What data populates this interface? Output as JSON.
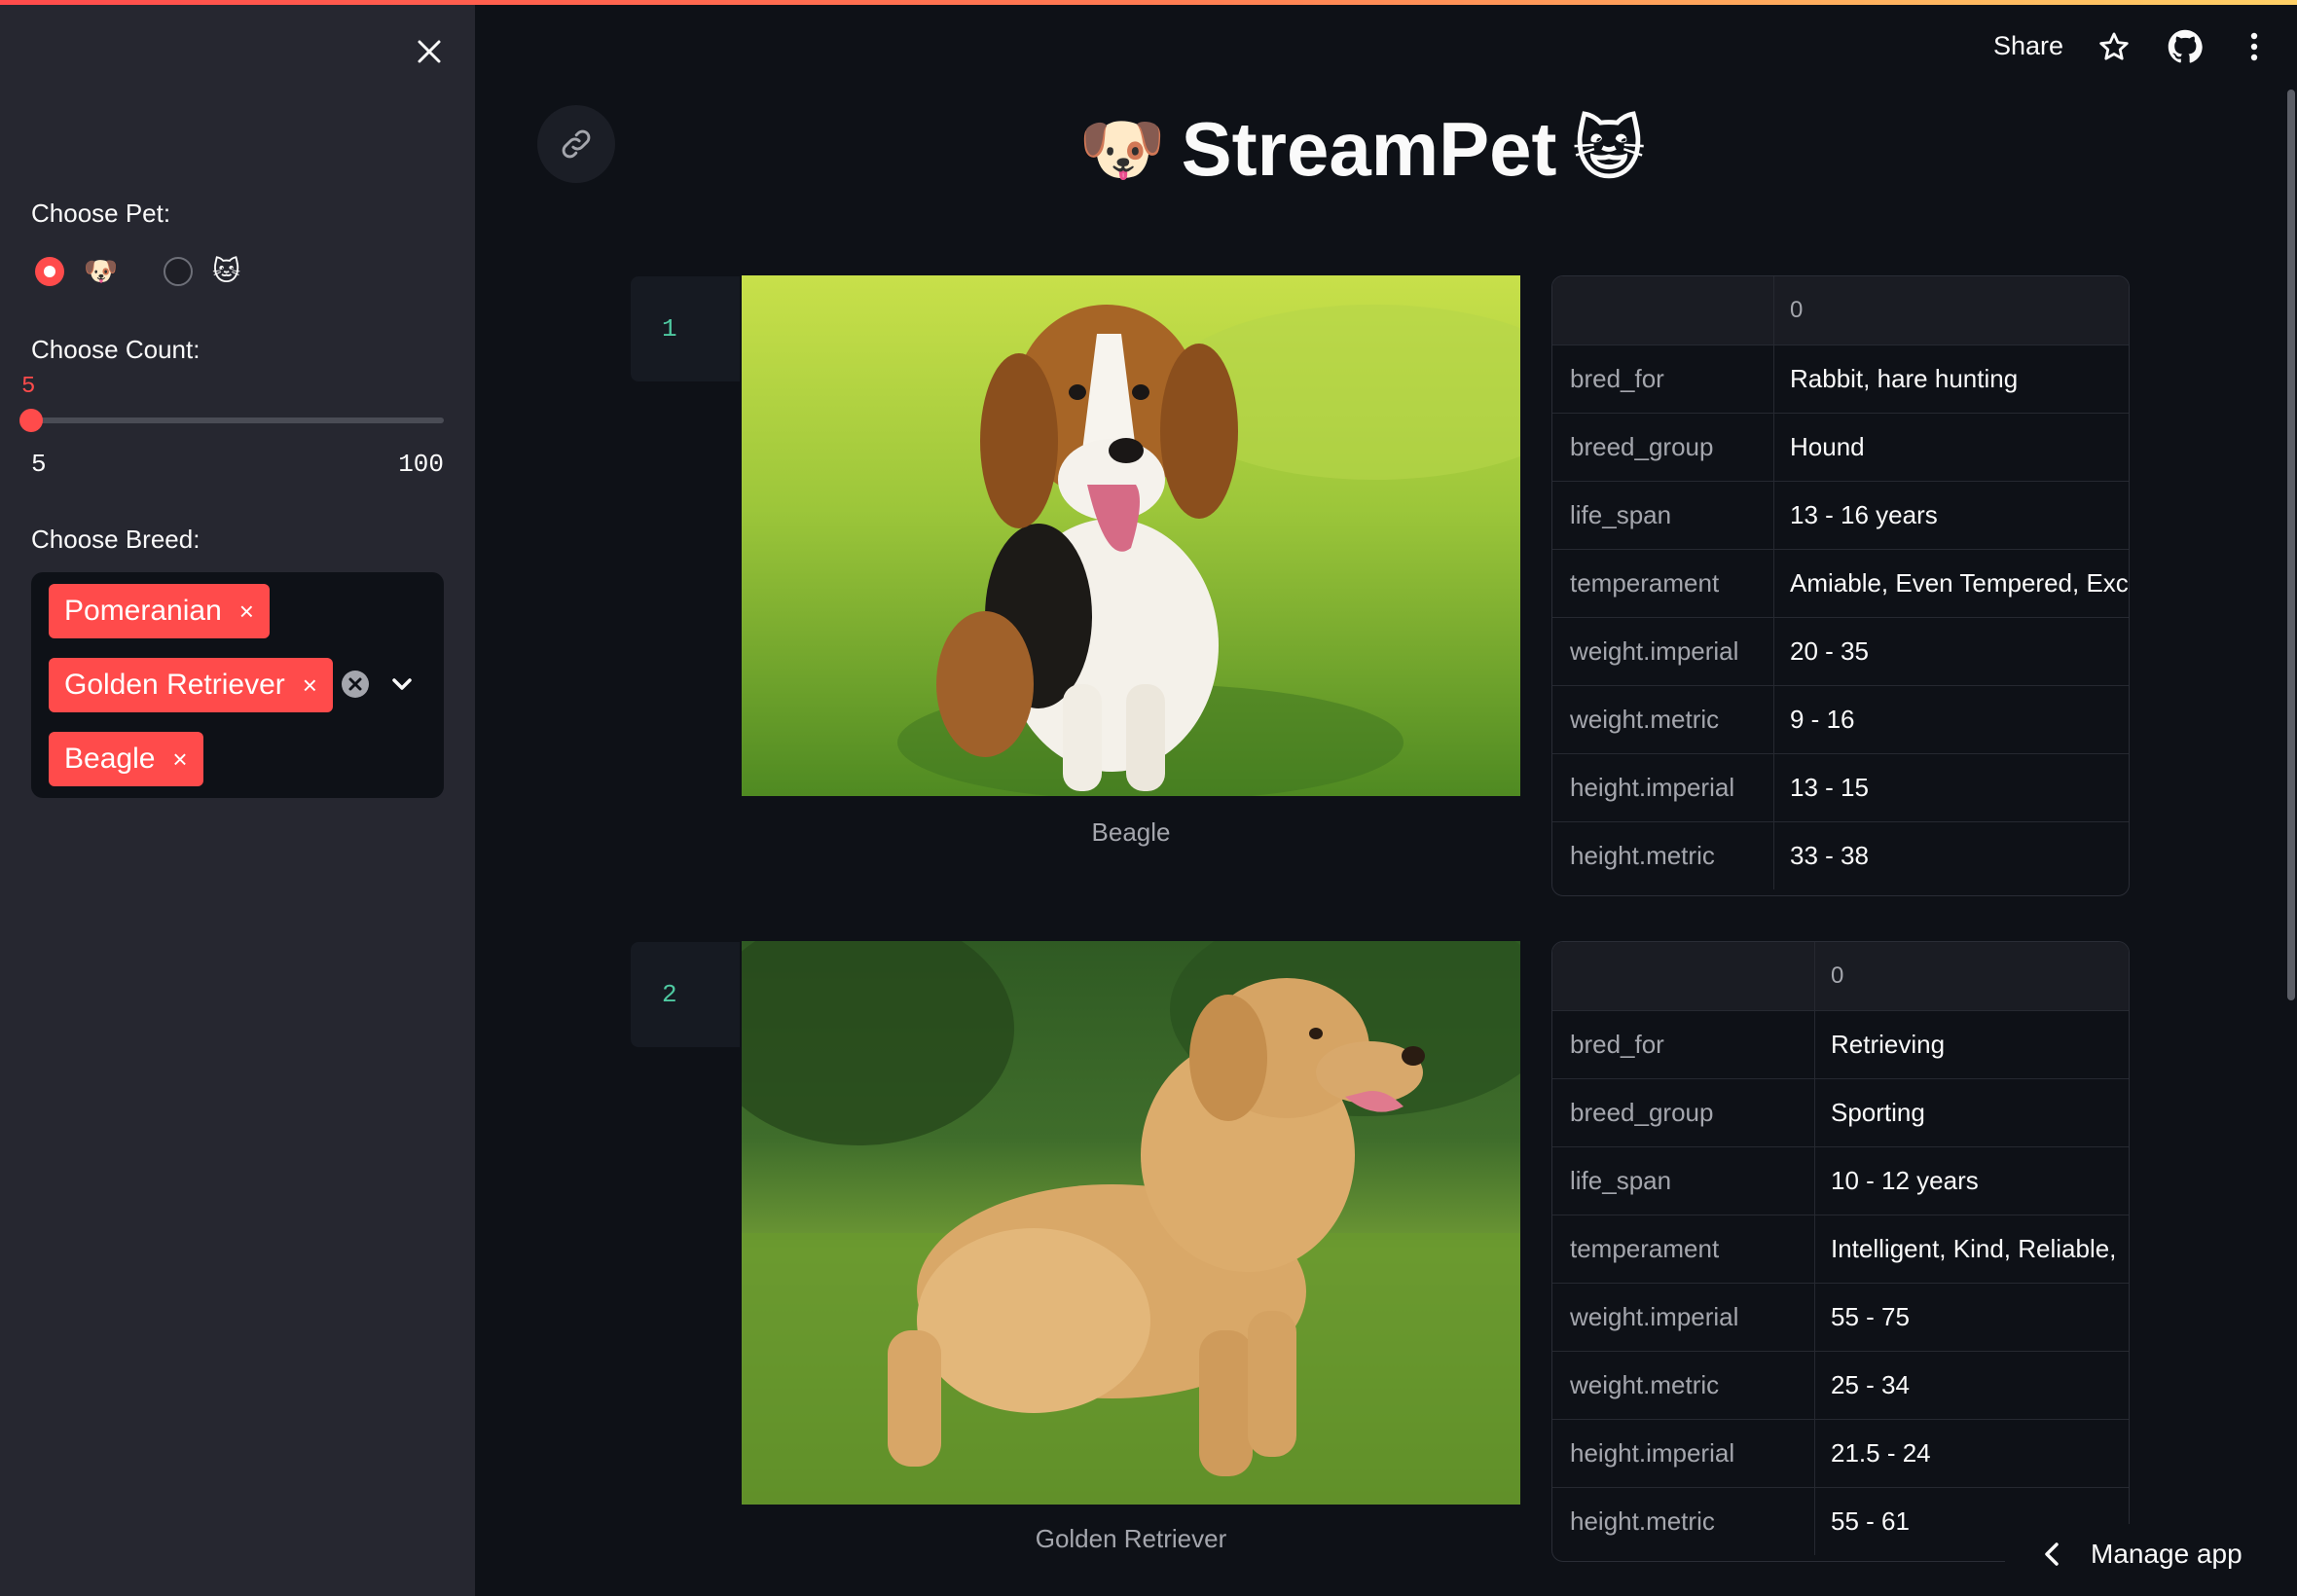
{
  "sidebar": {
    "pet_label": "Choose Pet:",
    "pet_options": [
      "🐶",
      "🐱"
    ],
    "count_label": "Choose Count:",
    "count_value": "5",
    "count_min": "5",
    "count_max": "100",
    "breed_label": "Choose Breed:",
    "breeds": [
      "Pomeranian",
      "Golden Retriever",
      "Beagle"
    ],
    "chip_remove": "×"
  },
  "header": {
    "share": "Share"
  },
  "main": {
    "title_emoji_left": "🐶",
    "title": "StreamPet",
    "title_emoji_right": "😺",
    "rows": [
      {
        "index": "1",
        "caption": "Beagle",
        "column_header": "0",
        "fields": [
          [
            "bred_for",
            "Rabbit, hare hunting"
          ],
          [
            "breed_group",
            "Hound"
          ],
          [
            "life_span",
            "13 - 16 years"
          ],
          [
            "temperament",
            "Amiable, Even Tempered, Exci"
          ],
          [
            "weight.imperial",
            "20 - 35"
          ],
          [
            "weight.metric",
            "9 - 16"
          ],
          [
            "height.imperial",
            "13 - 15"
          ],
          [
            "height.metric",
            "33 - 38"
          ]
        ]
      },
      {
        "index": "2",
        "caption": "Golden Retriever",
        "column_header": "0",
        "fields": [
          [
            "bred_for",
            "Retrieving"
          ],
          [
            "breed_group",
            "Sporting"
          ],
          [
            "life_span",
            "10 - 12 years"
          ],
          [
            "temperament",
            "Intelligent, Kind, Reliable,"
          ],
          [
            "weight.imperial",
            "55 - 75"
          ],
          [
            "weight.metric",
            "25 - 34"
          ],
          [
            "height.imperial",
            "21.5 - 24"
          ],
          [
            "height.metric",
            "55 - 61"
          ]
        ]
      }
    ]
  },
  "footer": {
    "manage_app": "Manage app"
  },
  "colors": {
    "accent": "#ff4b4b",
    "background": "#0e1117",
    "sidebar": "#262730"
  }
}
